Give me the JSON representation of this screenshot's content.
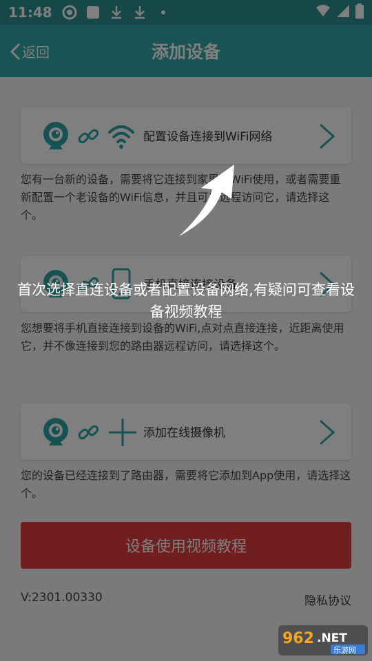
{
  "status_bar": {
    "time": "11:48"
  },
  "header": {
    "back_label": "返回",
    "title": "添加设备"
  },
  "options": [
    {
      "label": "配置设备连接到WiFi网络",
      "description": "您有一台新的设备，需要将它连接到家里到WiFi使用，或者需要重新配置一个老设备的WiFi信息，并且可以远程访问它，请选择这个。"
    },
    {
      "label": "手机直接连接设备",
      "description": "您想要将手机直接连接到设备的WiFi,点对点直接连接，近距离使用它，并不像连接到您的路由器远程访问，请选择这个。"
    },
    {
      "label": "添加在线摄像机",
      "description": "您的设备已经连接到了路由器，需要将它添加到App使用，请选择这个。"
    }
  ],
  "tutorial_button": "设备使用视频教程",
  "footer": {
    "version": "V:2301.00330",
    "privacy": "隐私协议"
  },
  "guide_overlay": {
    "message": "首次选择直连设备或者配置设备网络,有疑问可查看设备视频教程"
  },
  "watermark": {
    "text": "962.NET 乐游网"
  },
  "colors": {
    "accent": "#34a7a9",
    "status_bar": "#2c8f93",
    "button": "#e03c3c"
  },
  "icons": [
    "camera-icon",
    "link-icon",
    "wifi-icon",
    "phone-icon",
    "plus-icon",
    "chevron-right-icon",
    "back-arrow-icon"
  ]
}
